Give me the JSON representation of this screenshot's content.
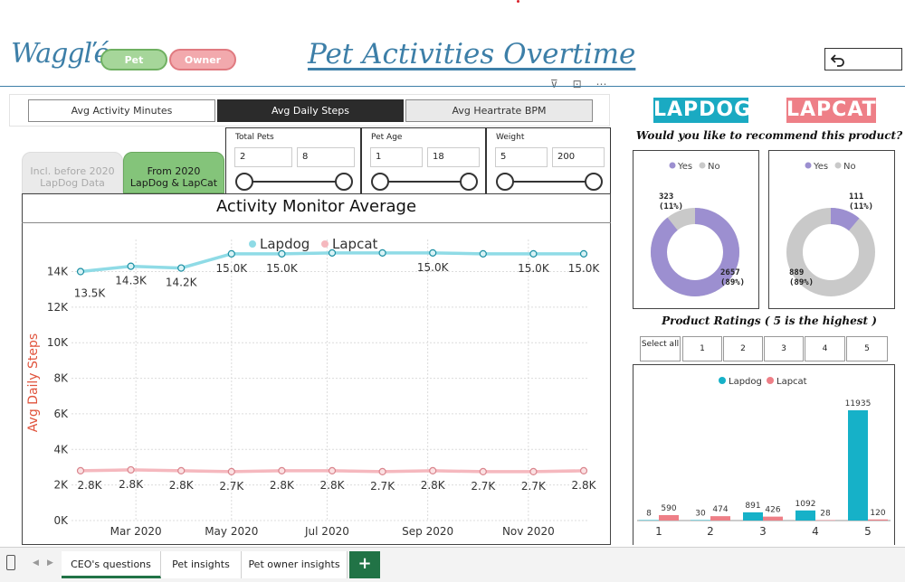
{
  "header": {
    "logo": "Waggľé",
    "pill_pet": "Pet",
    "pill_owner": "Owner",
    "title": "Pet Activities Overtime",
    "back_icon": "undo-arrow-icon",
    "tool_icons": "⊽ ⊡ ⋯"
  },
  "metric_tabs": [
    "Avg Activity Minutes",
    "Avg Daily Steps",
    "Avg Heartrate BPM"
  ],
  "metric_active": "Avg Daily Steps",
  "data_tabs": [
    {
      "line1": "Incl. before 2020",
      "line2": "LapDog Data",
      "active": false
    },
    {
      "line1": "From 2020",
      "line2": "LapDog & LapCat",
      "active": true
    }
  ],
  "slicers": [
    {
      "title": "Total Pets",
      "min": "2",
      "max": "8"
    },
    {
      "title": "Pet Age",
      "min": "1",
      "max": "18"
    },
    {
      "title": "Weight",
      "min": "5",
      "max": "200"
    }
  ],
  "chart_data": {
    "type": "line",
    "title": "Activity Monitor Average",
    "ylabel": "Avg Daily Steps",
    "xlabel": "",
    "ylim": [
      0,
      15500
    ],
    "yticks": [
      0,
      2000,
      4000,
      6000,
      8000,
      10000,
      12000,
      14000
    ],
    "ytick_labels": [
      "0K",
      "2K",
      "4K",
      "6K",
      "8K",
      "10K",
      "12K",
      "14K"
    ],
    "xtick_labels": [
      "Mar 2020",
      "May 2020",
      "Jul 2020",
      "Sep 2020",
      "Nov 2020"
    ],
    "xtick_positions": [
      1.1,
      3.0,
      4.9,
      6.9,
      8.9
    ],
    "legend": "top-center",
    "grid": true,
    "series": [
      {
        "name": "Lapdog",
        "color": "#8fdbe6",
        "values": [
          14000,
          14300,
          14200,
          15000,
          15000,
          15050,
          15050,
          15050,
          15000,
          15000,
          15000
        ],
        "labels": [
          "13.5K",
          "14.3K",
          "14.2K",
          "15.0K",
          "15.0K",
          "",
          "",
          "15.0K",
          "",
          "15.0K",
          "15.0K"
        ]
      },
      {
        "name": "Lapcat",
        "color": "#f5b8be",
        "values": [
          2800,
          2850,
          2800,
          2750,
          2800,
          2800,
          2750,
          2800,
          2750,
          2750,
          2800
        ],
        "labels": [
          "2.8K",
          "2.8K",
          "2.8K",
          "2.7K",
          "2.8K",
          "2.8K",
          "2.7K",
          "2.8K",
          "2.7K",
          "2.7K",
          "2.8K"
        ]
      }
    ]
  },
  "brands": {
    "dog": "LAPDOG",
    "cat": "LAPCAT"
  },
  "recommend": {
    "question": "Would you like to recommend this product?",
    "legend_yes": "Yes",
    "legend_no": "No",
    "yes_color": "#9c8fd0",
    "no_color": "#c9c9c9",
    "lapdog": {
      "yes": 2657,
      "yes_pct": "(89%)",
      "no": 323,
      "no_pct": "(11%)"
    },
    "lapcat": {
      "yes": 111,
      "yes_pct": "(11%)",
      "no": 889,
      "no_pct": "(89%)"
    }
  },
  "ratings": {
    "title": "Product Ratings ( 5 is the highest )",
    "buttons": [
      "Select all",
      "1",
      "2",
      "3",
      "4",
      "5"
    ],
    "chart": {
      "type": "bar",
      "categories": [
        "1",
        "2",
        "3",
        "4",
        "5"
      ],
      "series": [
        {
          "name": "Lapdog",
          "color": "#16b1c8",
          "values": [
            8,
            30,
            891,
            1092,
            11935
          ]
        },
        {
          "name": "Lapcat",
          "color": "#ee7f87",
          "values": [
            590,
            474,
            426,
            28,
            120
          ]
        }
      ]
    }
  },
  "sheets": [
    "CEO's questions",
    "Pet insights",
    "Pet owner insights"
  ],
  "active_sheet": "CEO's questions",
  "add_sheet": "+"
}
